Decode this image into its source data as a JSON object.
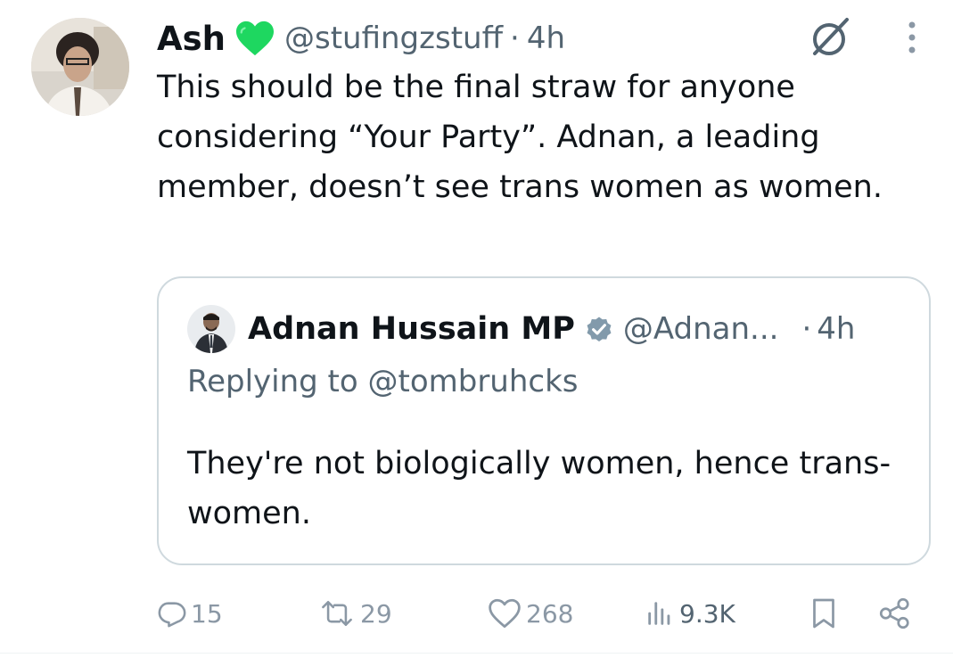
{
  "tweet": {
    "author_name": "Ash",
    "author_handle": "@stufingzstuff",
    "separator": "·",
    "time": "4h",
    "text": "This should be the final straw for anyone considering “Your Party”. Adnan, a leading member, doesn’t see trans women as women."
  },
  "quoted_tweet": {
    "author_name": "Adnan Hussain MP",
    "author_handle": "@Adnan...",
    "separator": "·",
    "time": "4h",
    "replying_to": "Replying to @tombruhcks",
    "text": "They're not biologically women, hence trans-women."
  },
  "actions": {
    "replies": "15",
    "reposts": "29",
    "likes": "268",
    "views": "9.3K"
  },
  "icons": [
    "green-heart-icon",
    "grok-icon",
    "more-options-icon",
    "verified-badge-icon",
    "reply-icon",
    "repost-icon",
    "like-icon",
    "views-icon",
    "bookmark-icon",
    "share-icon"
  ],
  "colors": {
    "text": "#0f1419",
    "secondary": "#536471",
    "action_gray": "#8b98a5",
    "heart_green": "#1ed760",
    "verified_gray": "#829aab",
    "quote_border": "#cfd9de"
  }
}
